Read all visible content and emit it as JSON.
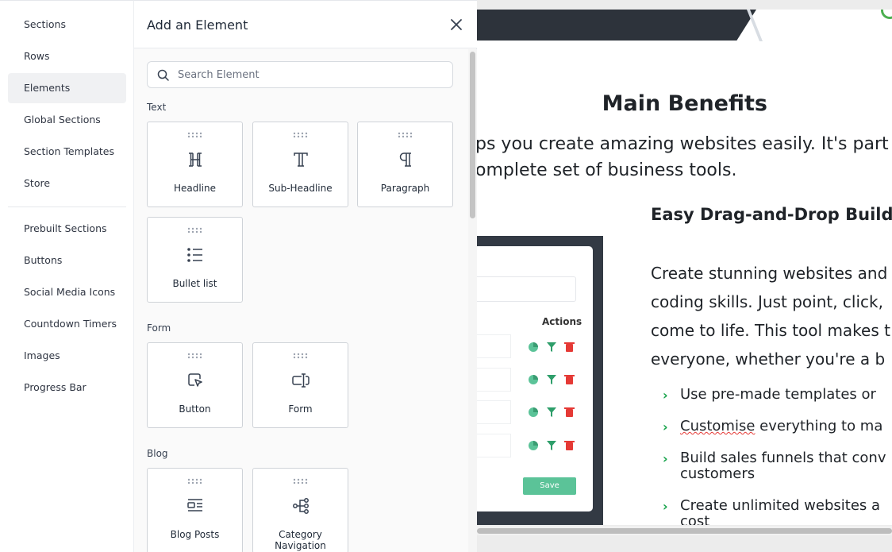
{
  "nav": {
    "items": [
      {
        "label": "Sections",
        "active": false
      },
      {
        "label": "Rows",
        "active": false
      },
      {
        "label": "Elements",
        "active": true
      },
      {
        "label": "Global Sections",
        "active": false
      },
      {
        "label": "Section Templates",
        "active": false
      },
      {
        "label": "Store",
        "active": false
      }
    ],
    "items2": [
      {
        "label": "Prebuilt Sections"
      },
      {
        "label": "Buttons"
      },
      {
        "label": "Social Media Icons"
      },
      {
        "label": "Countdown Timers"
      },
      {
        "label": "Images"
      },
      {
        "label": "Progress Bar"
      }
    ]
  },
  "panel": {
    "title": "Add an Element",
    "search_placeholder": "Search Element",
    "categories": [
      {
        "name": "Text",
        "elements": [
          {
            "label": "Headline",
            "icon": "headline-icon"
          },
          {
            "label": "Sub-Headline",
            "icon": "sub-headline-icon"
          },
          {
            "label": "Paragraph",
            "icon": "paragraph-icon"
          },
          {
            "label": "Bullet list",
            "icon": "bullet-list-icon"
          }
        ]
      },
      {
        "name": "Form",
        "elements": [
          {
            "label": "Button",
            "icon": "button-pointer-icon"
          },
          {
            "label": "Form",
            "icon": "form-icon"
          }
        ]
      },
      {
        "name": "Blog",
        "elements": [
          {
            "label": "Blog Posts",
            "icon": "blog-posts-icon"
          },
          {
            "label": "Category Navigation",
            "icon": "category-navigation-icon"
          }
        ]
      }
    ]
  },
  "preview": {
    "title": "Main Benefits",
    "intro_line1": "ps you create amazing websites easily. It's part o",
    "intro_line2": "omplete set of business tools.",
    "subhead": "Easy Drag-and-Drop Buildin",
    "para_lines": [
      "Create stunning websites and",
      "coding skills. Just point, click,",
      "come to life. This tool makes t",
      "everyone, whether you're a b"
    ],
    "bullets": {
      "b1": "Use pre-made templates or",
      "b2_word": "Customise",
      "b2_rest": " everything to ma",
      "b3_line1": "Build sales funnels that conv",
      "b3_line2": "customers",
      "b4_line1": "Create unlimited websites a",
      "b4_line2": "cost"
    },
    "mock": {
      "actions_label": "Actions",
      "save_label": "Save"
    }
  },
  "colors": {
    "accent_green": "#16a34a",
    "save_green": "#5bc398",
    "delete_red": "#e53935",
    "dark_band": "#2d333b"
  }
}
